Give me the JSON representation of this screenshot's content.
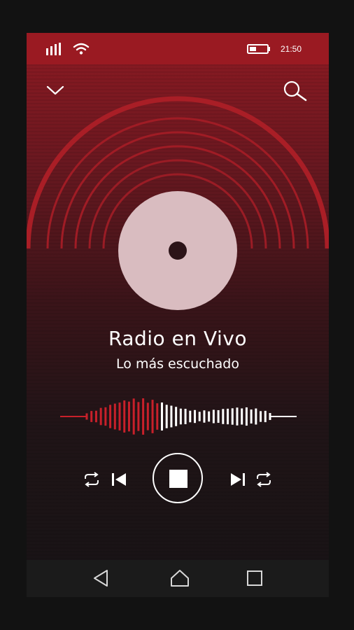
{
  "status_bar": {
    "time": "21:50"
  },
  "player": {
    "title": "Radio en Vivo",
    "subtitle": "Lo más escuchado"
  },
  "icons": {
    "signal": "signal-icon",
    "wifi": "wifi-icon",
    "battery": "battery-icon",
    "collapse": "chevron-down-icon",
    "search": "search-icon",
    "disc": "disc-icon",
    "shuffle": "repeat-icon",
    "previous": "skip-previous-icon",
    "stop": "stop-icon",
    "next": "skip-next-icon",
    "repeat": "repeat-icon",
    "back": "back-icon",
    "home": "home-icon",
    "recents": "recents-icon"
  },
  "colors": {
    "accent": "#c8202a",
    "statusbar": "#9a1a22",
    "text": "#ffffff"
  },
  "playback": {
    "progress": 0.4
  }
}
